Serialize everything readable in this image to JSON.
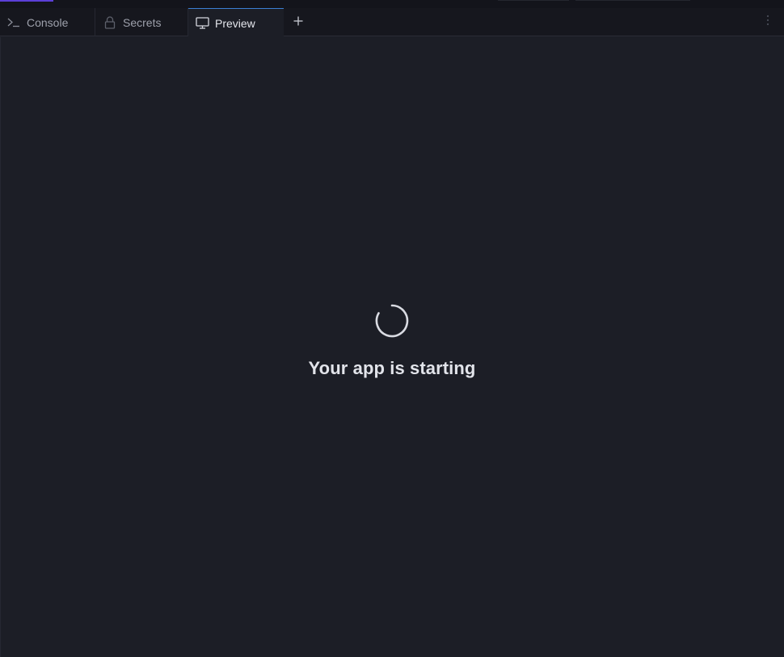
{
  "tabs": [
    {
      "id": "console",
      "label": "Console",
      "icon": "terminal-icon"
    },
    {
      "id": "secrets",
      "label": "Secrets",
      "icon": "lock-icon"
    },
    {
      "id": "preview",
      "label": "Preview",
      "icon": "monitor-icon",
      "active": true
    }
  ],
  "tabbar": {
    "add_icon": "plus-icon",
    "menu_icon": "more-vertical-icon"
  },
  "main": {
    "status_text": "Your app is starting",
    "spinner_icon": "loading-spinner-icon"
  },
  "colors": {
    "background": "#1c1e26",
    "tabbar_background": "#16171e",
    "active_tab_border": "#3b7fd4",
    "top_accent": "#5b3fd8",
    "text_primary": "#e2e4ea",
    "text_muted": "#9da0ab"
  }
}
